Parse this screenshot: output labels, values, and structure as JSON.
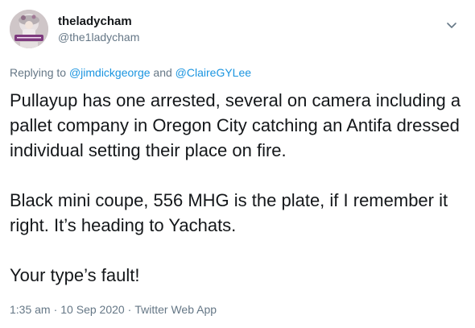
{
  "author": {
    "display_name": "theladycham",
    "handle": "@the1ladycham"
  },
  "reply": {
    "prefix": "Replying to ",
    "mention_1": "@jimdickgeorge",
    "joiner": " and ",
    "mention_2": "@ClaireGYLee"
  },
  "tweet": {
    "paragraph_1": "Pullayup has one arrested, several on camera including a pallet company in Oregon City catching an Antifa dressed individual setting their place on fire.",
    "paragraph_2": "Black mini coupe, 556 MHG is the plate, if I remember it right.  It’s heading to Yachats.",
    "paragraph_3": "Your type’s fault!"
  },
  "meta": {
    "time": "1:35 am",
    "separator_1": "·",
    "date": "10 Sep 2020",
    "separator_2": "·",
    "source": "Twitter Web App"
  },
  "icons": {
    "menu": "chevron-down-icon",
    "avatar": "profile-avatar"
  },
  "colors": {
    "text": "#14171a",
    "secondary": "#657786",
    "link": "#1b95e0"
  }
}
